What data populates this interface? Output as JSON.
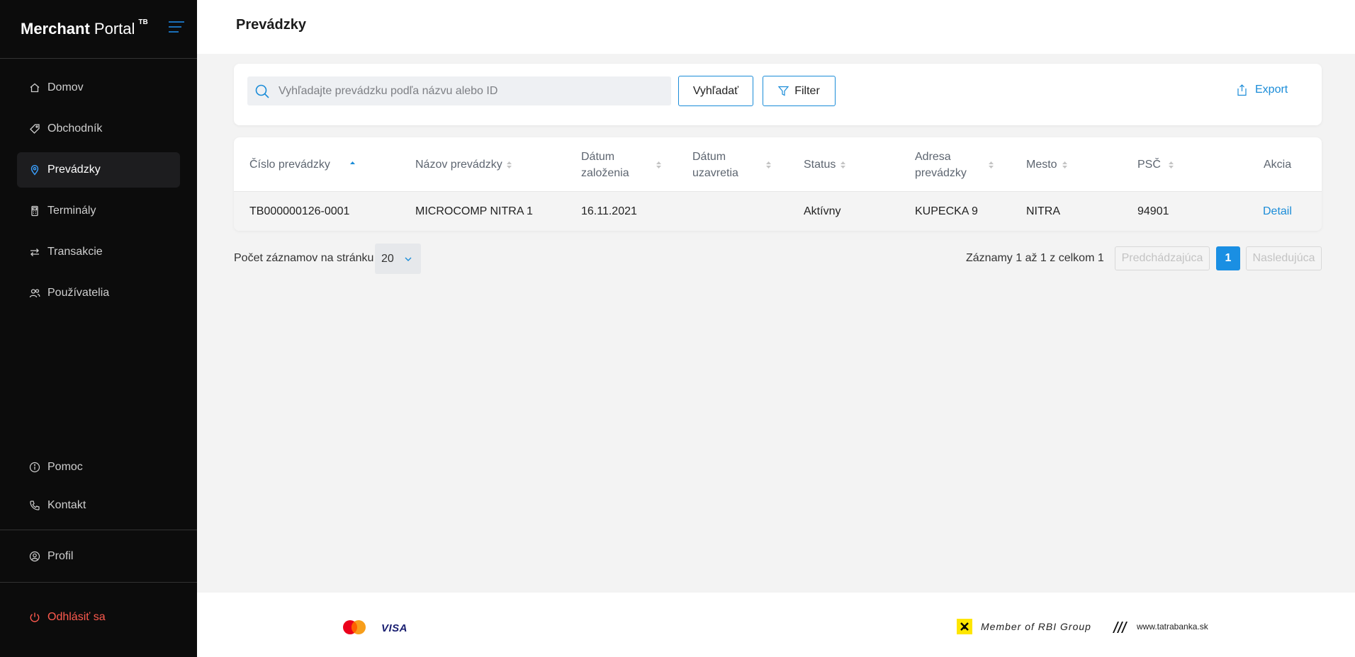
{
  "app": {
    "brand_bold": "Merchant",
    "brand_rest": "Portal",
    "brand_badge": "TB"
  },
  "sidebar": {
    "items": [
      {
        "label": "Domov",
        "icon": "home-icon",
        "active": false
      },
      {
        "label": "Obchodník",
        "icon": "tag-icon",
        "active": false
      },
      {
        "label": "Prevádzky",
        "icon": "location-pin-icon",
        "active": true
      },
      {
        "label": "Terminály",
        "icon": "terminal-icon",
        "active": false
      },
      {
        "label": "Transakcie",
        "icon": "transfer-arrows-icon",
        "active": false
      },
      {
        "label": "Používatelia",
        "icon": "users-icon",
        "active": false
      }
    ],
    "help_label": "Pomoc",
    "contact_label": "Kontakt",
    "profile_label": "Profil",
    "logout_label": "Odhlásiť sa"
  },
  "header": {
    "title": "Prevádzky"
  },
  "search": {
    "placeholder": "Vyhľadajte prevádzku podľa názvu alebo ID",
    "value": "",
    "search_button": "Vyhľadať",
    "filter_button": "Filter",
    "export_label": "Export"
  },
  "table": {
    "columns": [
      {
        "line1": "Číslo prevádzky",
        "line2": "",
        "sorted": "asc"
      },
      {
        "line1": "Názov prevádzky",
        "line2": "",
        "sorted": "none"
      },
      {
        "line1": "Dátum",
        "line2": "založenia",
        "sorted": "none"
      },
      {
        "line1": "Dátum",
        "line2": "uzavretia",
        "sorted": "none"
      },
      {
        "line1": "Status",
        "line2": "",
        "sorted": "none"
      },
      {
        "line1": "Adresa",
        "line2": "prevádzky",
        "sorted": "none"
      },
      {
        "line1": "Mesto",
        "line2": "",
        "sorted": "none"
      },
      {
        "line1": "PSČ",
        "line2": "",
        "sorted": "none"
      },
      {
        "line1": "Akcia",
        "line2": "",
        "sorted": "none"
      }
    ],
    "rows": [
      {
        "id": "TB000000126-0001",
        "name": "MICROCOMP NITRA 1",
        "created": "16.11.2021",
        "closed": "",
        "status": "Aktívny",
        "address": "KUPECKA 9",
        "city": "NITRA",
        "zip": "94901",
        "action": "Detail"
      }
    ]
  },
  "pagination": {
    "page_size_label": "Počet záznamov na stránku",
    "page_size": "20",
    "records_info": "Záznamy 1 až 1 z celkom 1",
    "prev_label": "Predchádzajúca",
    "current_page": "1",
    "next_label": "Nasledujúca"
  },
  "footer": {
    "visa_label": "VISA",
    "rbi_label": "Member of RBI Group",
    "website": "www.tatrabanka.sk"
  },
  "colors": {
    "accent": "#1a8cd8",
    "sidebar_bg": "#0c0c0c",
    "logout": "#ff5a4e",
    "page_bg": "#f3f3f3"
  }
}
